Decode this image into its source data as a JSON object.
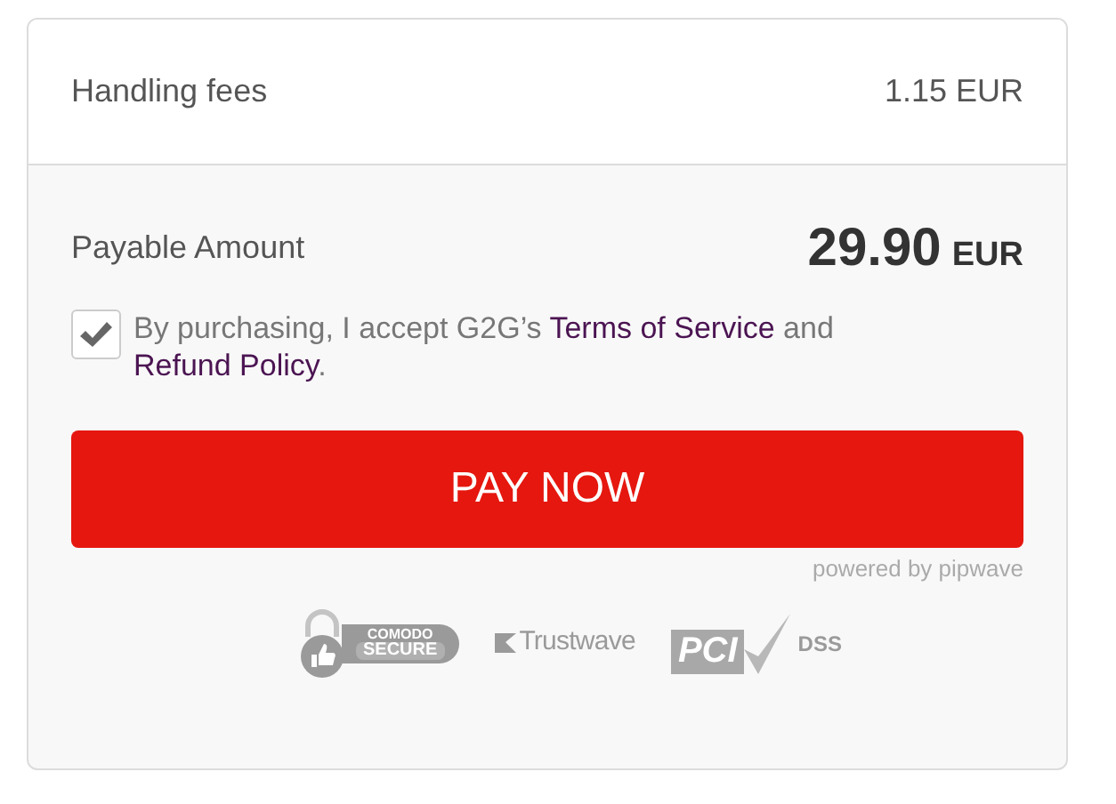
{
  "fees": {
    "label": "Handling fees",
    "value": "1.15 EUR"
  },
  "payable": {
    "label": "Payable Amount",
    "amount": "29.90",
    "currency": "EUR"
  },
  "consent": {
    "checked": true,
    "parts": [
      {
        "kind": "text",
        "text": "By purchasing, I accept G2G’s "
      },
      {
        "kind": "link",
        "text": "Terms of Service"
      },
      {
        "kind": "text",
        "text": " and "
      },
      {
        "kind": "link",
        "text": "Refund Policy"
      },
      {
        "kind": "text",
        "text": "."
      }
    ]
  },
  "pay_button": "PAY NOW",
  "powered_by": "powered by pipwave",
  "badges": [
    {
      "kind": "comodo",
      "lines": [
        "COMODO",
        "SECURE"
      ]
    },
    {
      "kind": "trustwave",
      "lines": [
        "Trustwave"
      ]
    },
    {
      "kind": "pci",
      "lines": [
        "PCI",
        "DSS"
      ]
    }
  ]
}
